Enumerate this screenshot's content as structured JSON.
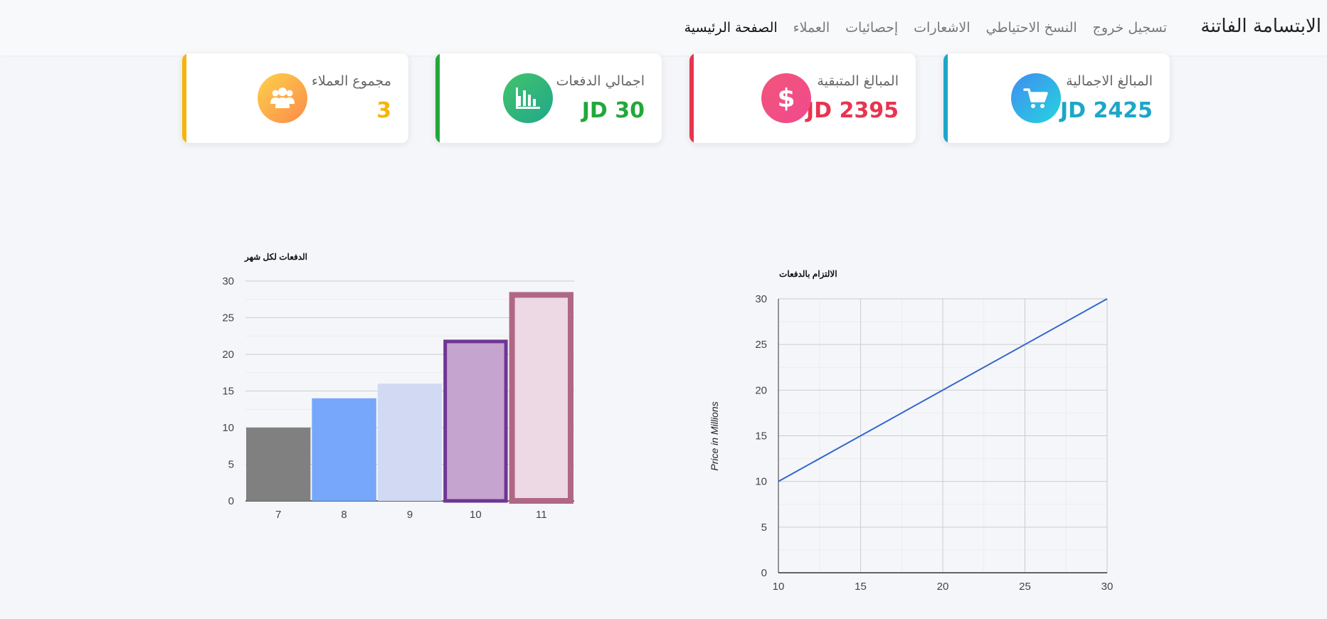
{
  "navbar": {
    "brand": "الابتسامة الفاتنة",
    "links": [
      {
        "label": "الصفحة الرئيسية",
        "active": true
      },
      {
        "label": "العملاء",
        "active": false
      },
      {
        "label": "إحصائيات",
        "active": false
      },
      {
        "label": "الاشعارات",
        "active": false
      },
      {
        "label": "النسخ الاحتياطي",
        "active": false
      },
      {
        "label": "تسجيل خروج",
        "active": false
      }
    ]
  },
  "cards": [
    {
      "title": "المبالغ الاجمالية",
      "value": "JD 2425",
      "accent": "#1ca7c7",
      "icon": "shopping-cart-icon"
    },
    {
      "title": "المبالغ المتبقية",
      "value": "JD 2395",
      "accent": "#e8344f",
      "icon": "dollar-icon"
    },
    {
      "title": "اجمالي الدفعات",
      "value": "JD 30",
      "accent": "#22a83a",
      "icon": "bar-chart-icon"
    },
    {
      "title": "مجموع العملاء",
      "value": "3",
      "accent": "#f5b50c",
      "icon": "users-icon"
    }
  ],
  "chart_data": [
    {
      "type": "bar",
      "title": "الدفعات لكل شهر",
      "categories": [
        "7",
        "8",
        "9",
        "10",
        "11"
      ],
      "values": [
        10,
        14,
        16,
        22,
        28.5
      ],
      "colors": [
        "#808080",
        "#76a7fa",
        "#d2daf3",
        "#c5a5cf",
        "#ecd9e4"
      ],
      "strokes": [
        "none",
        "none",
        "none",
        "#703593",
        "#b06785"
      ],
      "yticks": [
        0,
        5,
        10,
        15,
        20,
        25,
        30
      ],
      "ylim": [
        0,
        30
      ],
      "grid": true
    },
    {
      "type": "line",
      "title": "الالتزام بالدفعات",
      "ylabel": "Price in Millions",
      "series": [
        {
          "x": [
            10,
            30
          ],
          "y": [
            10,
            30
          ],
          "color": "#3366cc"
        }
      ],
      "xticks": [
        10,
        15,
        20,
        25,
        30
      ],
      "yticks": [
        0,
        5,
        10,
        15,
        20,
        25,
        30
      ],
      "xlim": [
        10,
        30
      ],
      "ylim": [
        0,
        30
      ],
      "grid": true
    }
  ]
}
